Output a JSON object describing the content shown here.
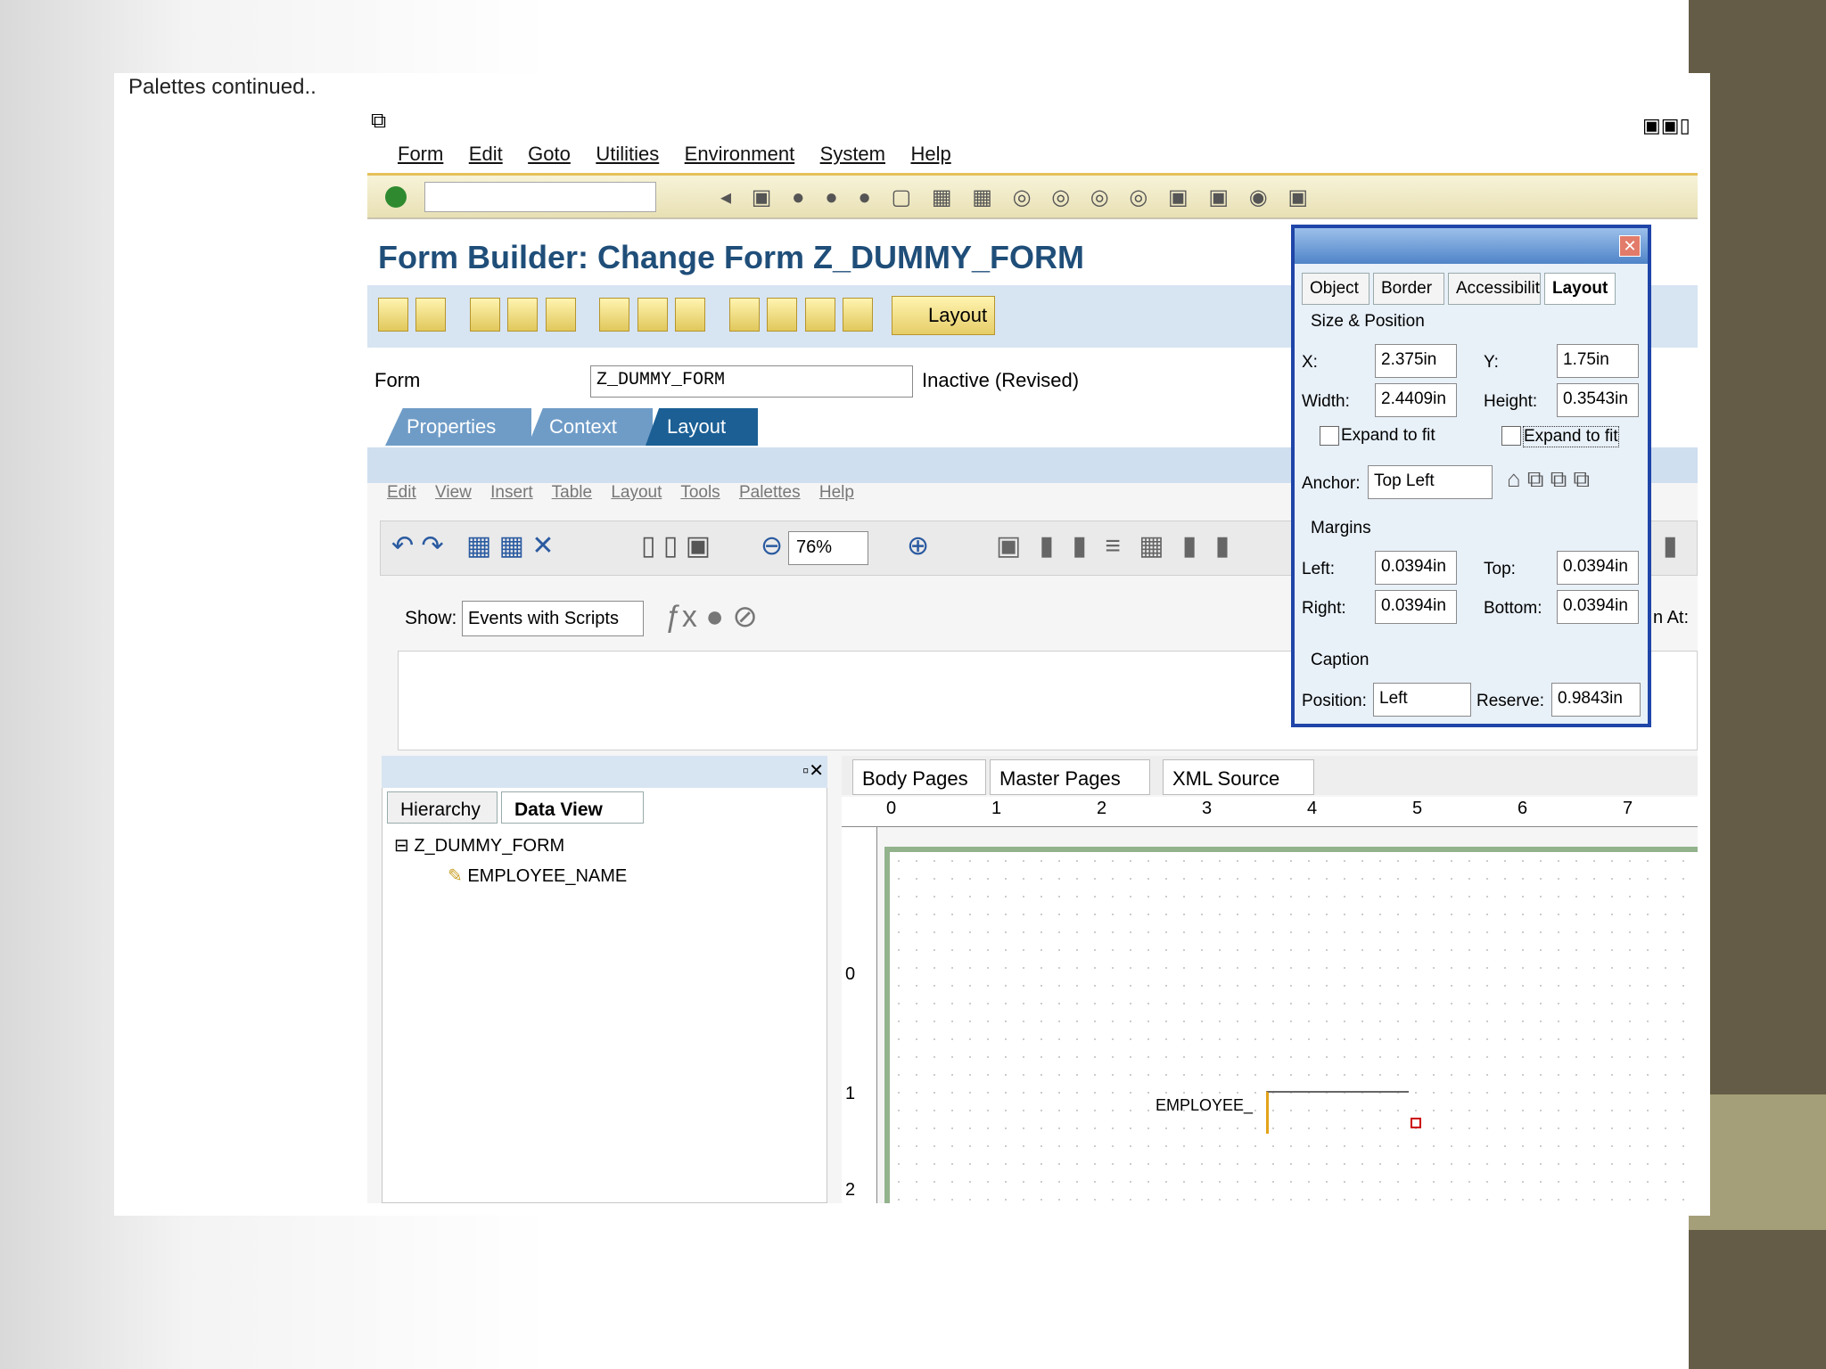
{
  "slide": {
    "caption": "Palettes continued.."
  },
  "menu": [
    "Form",
    "Edit",
    "Goto",
    "Utilities",
    "Environment",
    "System",
    "Help"
  ],
  "page_title": "Form Builder: Change Form Z_DUMMY_FORM",
  "layout_button": "Layout",
  "form": {
    "label": "Form",
    "value": "Z_DUMMY_FORM",
    "status": "Inactive (Revised)"
  },
  "tabs": [
    "Properties",
    "Context",
    "Layout"
  ],
  "designer_menu": [
    "Edit",
    "View",
    "Insert",
    "Table",
    "Layout",
    "Tools",
    "Palettes",
    "Help"
  ],
  "zoom": "76%",
  "show": {
    "label": "Show:",
    "value": "Events with Scripts"
  },
  "left_tabs": [
    "Hierarchy",
    "Data View"
  ],
  "tree": {
    "root": "Z_DUMMY_FORM",
    "child": "EMPLOYEE_NAME"
  },
  "canvas_tabs": [
    "Body Pages",
    "Master Pages",
    "XML Source"
  ],
  "ruler_h": [
    "0",
    "1",
    "2",
    "3",
    "4",
    "5",
    "6",
    "7"
  ],
  "ruler_v": [
    "0",
    "1",
    "2"
  ],
  "canvas_field_label": "EMPLOYEE_",
  "palette": {
    "tabs": [
      "Object",
      "Border",
      "Accessibilit",
      "Layout"
    ],
    "size_position": "Size & Position",
    "x_label": "X:",
    "x": "2.375in",
    "y_label": "Y:",
    "y": "1.75in",
    "width_label": "Width:",
    "width": "2.4409in",
    "height_label": "Height:",
    "height": "0.3543in",
    "expand_to_fit": "Expand to fit",
    "anchor_label": "Anchor:",
    "anchor": "Top Left",
    "margins": "Margins",
    "left_label": "Left:",
    "left": "0.0394in",
    "top_label": "Top:",
    "top": "0.0394in",
    "right_label": "Right:",
    "right": "0.0394in",
    "bottom_label": "Bottom:",
    "bottom": "0.0394in",
    "caption": "Caption",
    "position_label": "Position:",
    "position": "Left",
    "reserve_label": "Reserve:",
    "reserve": "0.9843in"
  },
  "clipped_label": "n At:",
  "colors": {
    "title": "#1f4e79",
    "tab_active": "#1b5f95",
    "tab": "#6f9cc7",
    "palette_border": "#1f45a8",
    "bar_dark": "#645c46",
    "bar_light": "#a59f79"
  }
}
